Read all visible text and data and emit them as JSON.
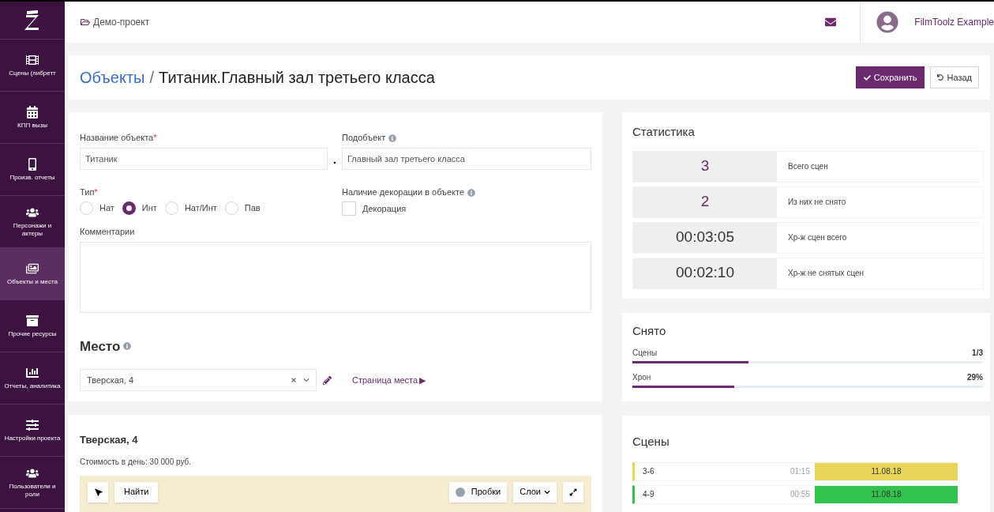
{
  "sidebar": {
    "items": [
      {
        "label": "Сцены (либретт",
        "selected": false
      },
      {
        "label": "КПП вызы",
        "selected": false
      },
      {
        "label": "Произв. отчеты",
        "selected": false
      },
      {
        "label": "Персонажи и актеры",
        "selected": false
      },
      {
        "label": "Объекты и места",
        "selected": true
      },
      {
        "label": "Прочие ресурсы",
        "selected": false
      },
      {
        "label": "Отчеты, аналитика",
        "selected": false
      },
      {
        "label": "Настройки проекта",
        "selected": false
      },
      {
        "label": "Пользователи и роли",
        "selected": false
      }
    ]
  },
  "header": {
    "project": "Демо-проект",
    "user": "FilmToolz Example"
  },
  "title": {
    "section": "Объекты",
    "separator": "/",
    "name": "Титаник.Главный зал третьего класса",
    "save": "Сохранить",
    "back": "Назад"
  },
  "form": {
    "required_mark": "*",
    "name_label": "Название объекта",
    "name_value": "Титаник",
    "separator": ".",
    "sub_label": "Подобъект",
    "sub_value": "Главный зал третьего класса",
    "type_label": "Тип",
    "types": [
      {
        "label": "Нат",
        "selected": false
      },
      {
        "label": "Инт",
        "selected": true
      },
      {
        "label": "Нат/Инт",
        "selected": false
      },
      {
        "label": "Пав",
        "selected": false
      }
    ],
    "decor_label": "Наличие декорации в объекте",
    "decor": {
      "label": "Декорация",
      "checked": false
    },
    "comments_label": "Комментарии"
  },
  "place": {
    "title": "Место",
    "value": "Тверская, 4",
    "link": "Страница места",
    "link_arrow": "▶"
  },
  "map_card": {
    "title": "Тверская, 4",
    "cost": "Стоимость в день: 30 000 руб.",
    "find": "Найти",
    "traffic": "Пробки",
    "layers": "Слои"
  },
  "stats": {
    "title": "Статистика",
    "rows": [
      {
        "value": "3",
        "label": "Всего сцен",
        "accent": true
      },
      {
        "value": "2",
        "label": "Из них не снято",
        "accent": true
      },
      {
        "value": "00:03:05",
        "label": "Хр-ж сцен всего",
        "accent": false
      },
      {
        "value": "00:02:10",
        "label": "Хр-ж не снятых сцен",
        "accent": false
      }
    ]
  },
  "shot": {
    "title": "Снято",
    "bars": [
      {
        "label": "Сцены",
        "reading": "1/3",
        "level": 0.33
      },
      {
        "label": "Хрон",
        "reading": "29%",
        "level": 0.29
      }
    ]
  },
  "scenes": {
    "title": "Сцены",
    "rows": [
      {
        "name": "3-6",
        "duration": "01:15",
        "date": "11.08.18",
        "color": "#e8d55a"
      },
      {
        "name": "4-9",
        "duration": "00:55",
        "date": "11.08.18",
        "color": "#33c24d"
      }
    ]
  }
}
